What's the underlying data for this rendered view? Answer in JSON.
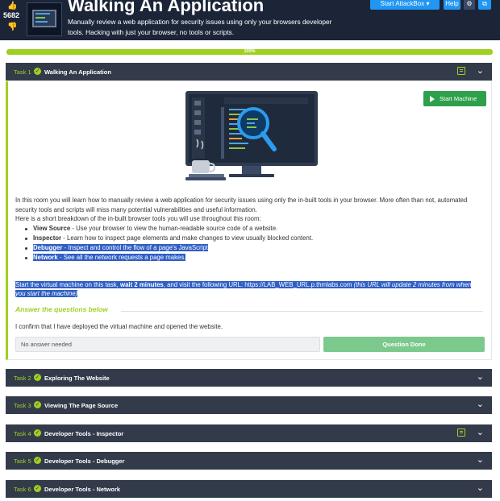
{
  "header": {
    "vote_count": "5682",
    "title": "Walking An Application",
    "description": "Manually review a web application for security issues using only your browsers developer tools. Hacking with just your browser, no tools or scripts.",
    "attackbox_label": "Start AttackBox",
    "help_label": "Help"
  },
  "progress": {
    "value": 1.0,
    "label": "100%"
  },
  "tasks": [
    {
      "number": "Task 1",
      "name": "Walking An Application",
      "expanded": true,
      "has_note": true
    },
    {
      "number": "Task 2",
      "name": "Exploring The Website",
      "expanded": false,
      "has_note": false
    },
    {
      "number": "Task 3",
      "name": "Viewing The Page Source",
      "expanded": false,
      "has_note": false
    },
    {
      "number": "Task 4",
      "name": "Developer Tools - Inspector",
      "expanded": false,
      "has_note": true
    },
    {
      "number": "Task 5",
      "name": "Developer Tools - Debugger",
      "expanded": false,
      "has_note": false
    },
    {
      "number": "Task 6",
      "name": "Developer Tools - Network",
      "expanded": false,
      "has_note": false
    }
  ],
  "task1": {
    "start_machine_label": "Start Machine",
    "intro": "In this room you will learn how to manually review a web application for security issues using only the in-built tools in your browser. More often than not, automated security tools and scripts will miss many potential vulnerabilities and useful information.",
    "breakdown_intro": "Here is a short breakdown of the in-built browser tools you will use throughout this room:",
    "bullets": [
      {
        "term": "View Source",
        "desc": " - Use your browser to view the human-readable source code of a website."
      },
      {
        "term": "Inspector",
        "desc": " - Learn how to inspect page elements and make changes to view usually blocked content."
      },
      {
        "term": "Debugger",
        "desc": " - Inspect and control the flow of a page's JavaScript"
      },
      {
        "term": "Network",
        "desc": " - See all the network requests a page makes."
      }
    ],
    "vm_text_1": "Start the virtual machine on this task, ",
    "vm_bold": "wait 2 minutes",
    "vm_text_2": ", and visit the following URL: https://LAB_WEB_URL.p.thmlabs.com ",
    "vm_note": "(this URL will update 2 minutes from when you start the machine)",
    "answer_heading": "Answer the questions below",
    "question": "I confirm that I have deployed the virtual machine and opened the website.",
    "answer_value": "No answer needed",
    "done_label": "Question Done"
  },
  "colors": {
    "header_bg": "#1c2538",
    "task_bar": "#333b4b",
    "accent_green": "#9fd020",
    "start_button": "#2ea04b",
    "done_button": "#7cc98d",
    "highlight": "#2f5ec4",
    "button_blue": "#2196f3"
  },
  "icons": [
    "thumbs-up-icon",
    "thumbs-down-icon",
    "gear-icon",
    "bookmark-icon",
    "check-circle-icon",
    "chevron-down-icon",
    "note-icon",
    "play-icon"
  ]
}
